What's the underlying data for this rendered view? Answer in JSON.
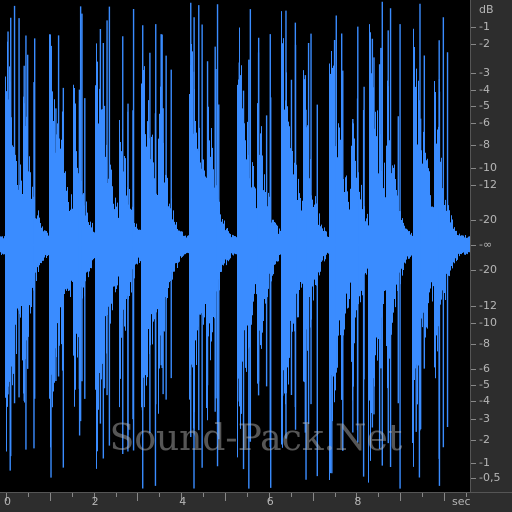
{
  "watermark": "Sound-Pack.Net",
  "colors": {
    "waveform": "#3a8cff",
    "background": "#000000",
    "ruler_bg": "#2d2d2d",
    "ruler_text": "#b5b5b5"
  },
  "db_scale": {
    "unit": "dB",
    "top_labels": [
      "-1",
      "-2",
      "-3",
      "-4",
      "-5",
      "-6",
      "-8",
      "-10",
      "-12",
      "-20"
    ],
    "center": "-∞",
    "bottom_labels": [
      "-20",
      "-12",
      "-10",
      "-8",
      "-6",
      "-5",
      "-4",
      "-3",
      "-2",
      "-1",
      "-0,5"
    ]
  },
  "time_scale": {
    "unit": "sec",
    "labels": [
      "0",
      "2",
      "4",
      "6",
      "8"
    ]
  },
  "chart_data": {
    "type": "area",
    "title": "",
    "xlabel": "sec",
    "ylabel": "dB",
    "x_range": [
      0,
      10.6
    ],
    "transients_sec": [
      0.0,
      0.4,
      1.0,
      1.55,
      2.05,
      2.6,
      3.1,
      3.5,
      4.2,
      4.6,
      5.3,
      5.75,
      6.3,
      6.8,
      7.4,
      7.9,
      8.3,
      8.7,
      9.3,
      9.8
    ]
  }
}
